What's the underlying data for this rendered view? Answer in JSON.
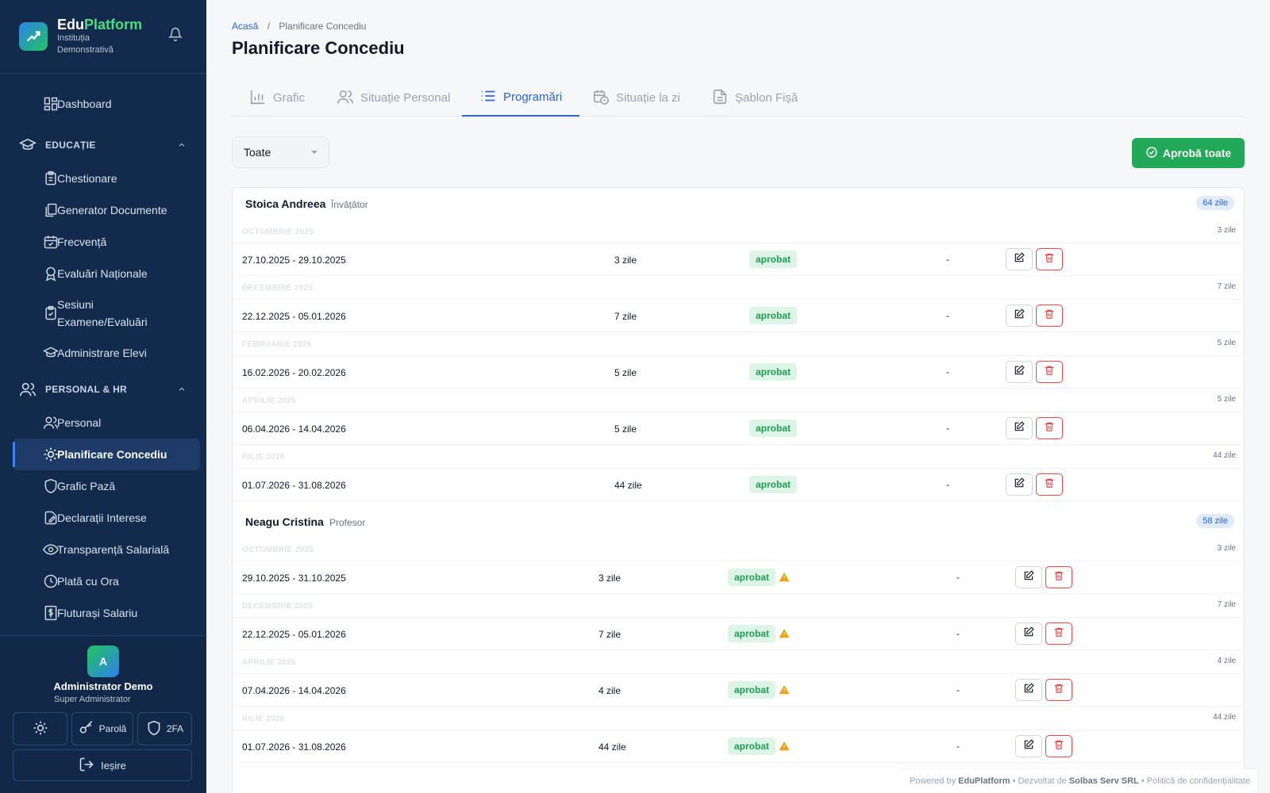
{
  "brand": {
    "name_part1": "Edu",
    "name_part2": "Platform",
    "institution": "Instituția Demonstrativă"
  },
  "nav": {
    "dashboard": "Dashboard",
    "education_section": "EDUCAȚIE",
    "education_items": [
      "Chestionare",
      "Generator Documente",
      "Frecvență",
      "Evaluări Naționale",
      "Sesiuni Examene/Evaluări",
      "Administrare Elevi"
    ],
    "hr_section": "PERSONAL & HR",
    "hr_items": [
      "Personal",
      "Planificare Concediu",
      "Grafic Pază",
      "Declarații Interese",
      "Transparență Salarială",
      "Plată cu Ora",
      "Fluturași Salariu"
    ]
  },
  "user": {
    "initial": "A",
    "name": "Administrator Demo",
    "role": "Super Administrator",
    "password_label": "Parolă",
    "twofa_label": "2FA",
    "logout_label": "Ieșire"
  },
  "breadcrumb": {
    "home": "Acasă",
    "separator": "/",
    "current": "Planificare Concediu"
  },
  "page_title": "Planificare Concediu",
  "tabs": [
    "Grafic",
    "Situație Personal",
    "Programări",
    "Situație la zi",
    "Șablon Fișă"
  ],
  "active_tab": "Programări",
  "filter": {
    "value": "Toate"
  },
  "approve_all_label": "Aprobă toate",
  "employees": [
    {
      "name": "Stoica Andreea",
      "role": "Învățător",
      "total": "64 zile",
      "months": [
        {
          "month": "OCTOMBRIE 2025",
          "days": "3 zile",
          "period": "27.10.2025 - 29.10.2025",
          "count": "3 zile",
          "status": "aprobat",
          "note": "-"
        },
        {
          "month": "DECEMBRIE 2025",
          "days": "7 zile",
          "period": "22.12.2025 - 05.01.2026",
          "count": "7 zile",
          "status": "aprobat",
          "note": "-"
        },
        {
          "month": "FEBRUARIE 2026",
          "days": "5 zile",
          "period": "16.02.2026 - 20.02.2026",
          "count": "5 zile",
          "status": "aprobat",
          "note": "-"
        },
        {
          "month": "APRILIE 2026",
          "days": "5 zile",
          "period": "06.04.2026 - 14.04.2026",
          "count": "5 zile",
          "status": "aprobat",
          "note": "-"
        },
        {
          "month": "IULIE 2026",
          "days": "44 zile",
          "period": "01.07.2026 - 31.08.2026",
          "count": "44 zile",
          "status": "aprobat",
          "note": "-"
        }
      ]
    },
    {
      "name": "Neagu Cristina",
      "role": "Profesor",
      "total": "58 zile",
      "months": [
        {
          "month": "OCTOMBRIE 2025",
          "days": "3 zile",
          "period": "29.10.2025 - 31.10.2025",
          "count": "3 zile",
          "status": "aprobat",
          "note": "-",
          "warning": true
        },
        {
          "month": "DECEMBRIE 2025",
          "days": "7 zile",
          "period": "22.12.2025 - 05.01.2026",
          "count": "7 zile",
          "status": "aprobat",
          "note": "-",
          "warning": true
        },
        {
          "month": "APRILIE 2026",
          "days": "4 zile",
          "period": "07.04.2026 - 14.04.2026",
          "count": "4 zile",
          "status": "aprobat",
          "note": "-",
          "warning": true
        },
        {
          "month": "IULIE 2026",
          "days": "44 zile",
          "period": "01.07.2026 - 31.08.2026",
          "count": "44 zile",
          "status": "aprobat",
          "note": "-",
          "warning": true
        }
      ]
    }
  ],
  "footer": {
    "powered": "Powered by",
    "brand": "EduPlatform",
    "sep1": "•",
    "dev": "Dezvoltat de",
    "company": "Solbas Serv SRL",
    "sep2": "•",
    "policy": "Politică de confidențialitate"
  },
  "colors": {
    "sidebar": "#122a4b",
    "accent": "#2563eb",
    "approve": "#22a957",
    "status_bg": "#dcf5e6",
    "status_text": "#1f9d55",
    "delete": "#ef4444"
  }
}
